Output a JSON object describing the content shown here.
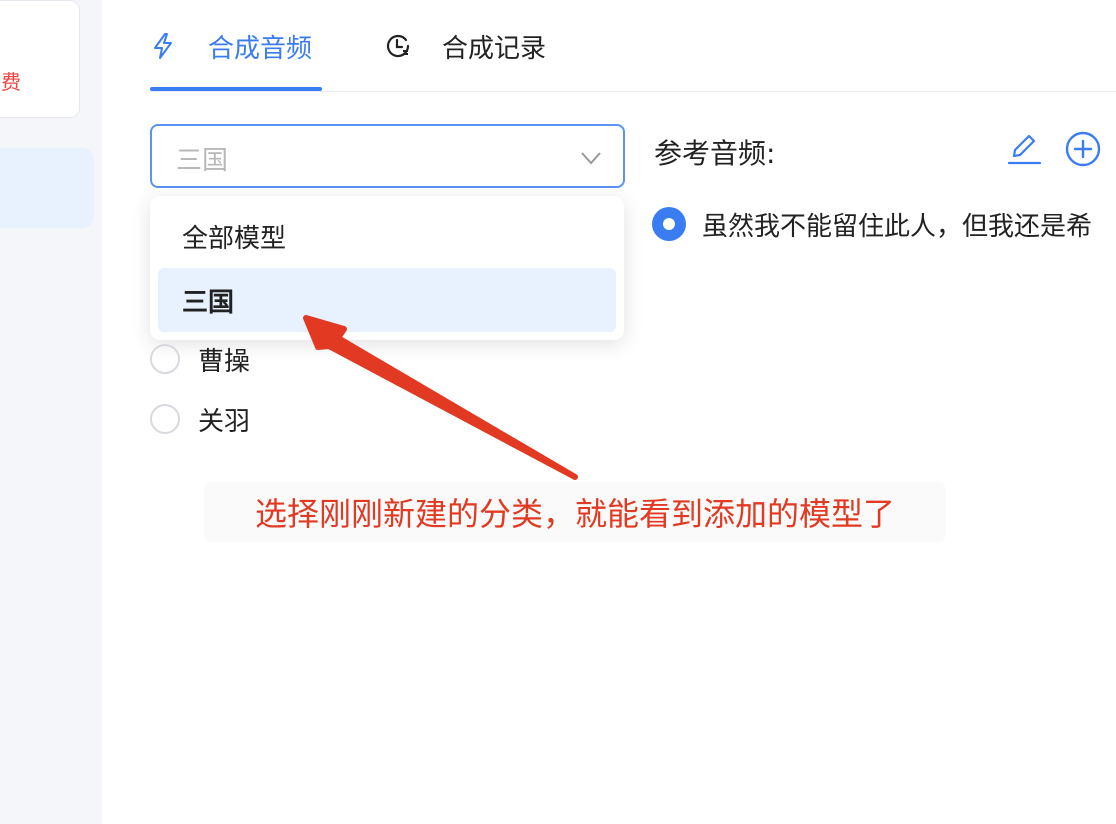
{
  "sidebar": {
    "card_text": "费"
  },
  "tabs": [
    {
      "label": "合成音频",
      "icon": "lightning-icon",
      "active": true
    },
    {
      "label": "合成记录",
      "icon": "clock-history-icon",
      "active": false
    }
  ],
  "model_select": {
    "value": "三国",
    "options": [
      "全部模型",
      "三国"
    ],
    "highlighted_option": "三国"
  },
  "models": [
    "曹操",
    "关羽"
  ],
  "reference": {
    "title": "参考音频:",
    "audio_text": "虽然我不能留住此人，但我还是希"
  },
  "annotation": {
    "text": "选择刚刚新建的分类，就能看到添加的模型了",
    "color": "#e23a22"
  },
  "colors": {
    "accent": "#3a7cf2",
    "fee": "#ef4444"
  }
}
